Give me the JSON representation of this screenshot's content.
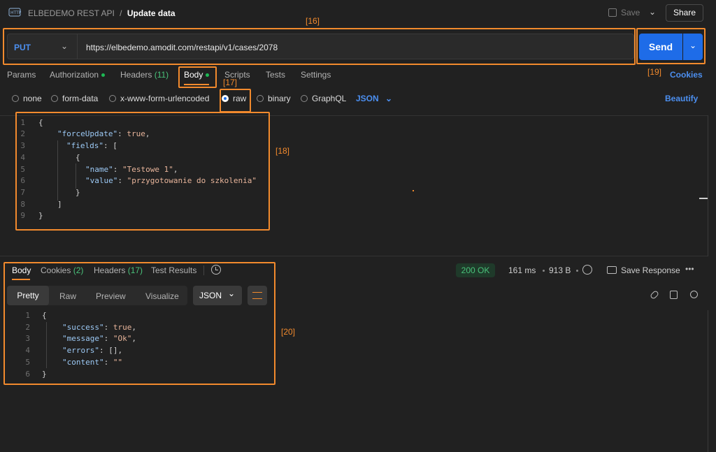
{
  "header": {
    "breadcrumb_collection": "ELBEDEMO REST API",
    "breadcrumb_sep": "/",
    "request_title": "Update data",
    "save_label": "Save",
    "share_label": "Share"
  },
  "request": {
    "method": "PUT",
    "url": "https://elbedemo.amodit.com/restapi/v1/cases/2078",
    "send_label": "Send",
    "cookies_label": "Cookies"
  },
  "request_tabs": {
    "params": "Params",
    "authorization": "Authorization",
    "headers": "Headers",
    "headers_count": "(11)",
    "body": "Body",
    "scripts": "Scripts",
    "tests": "Tests",
    "settings": "Settings"
  },
  "body_types": {
    "none": "none",
    "form_data": "form-data",
    "urlencoded": "x-www-form-urlencoded",
    "raw": "raw",
    "binary": "binary",
    "graphql": "GraphQL",
    "language": "JSON",
    "beautify": "Beautify"
  },
  "request_body": {
    "line_numbers": [
      "1",
      "2",
      "3",
      "4",
      "5",
      "6",
      "7",
      "8",
      "9"
    ],
    "l1": "{",
    "l2_key": "\"forceUpdate\"",
    "l2_rest": ": ",
    "l2_val": "true",
    "l2_end": ",",
    "l3_key": "\"fields\"",
    "l3_rest": ": [",
    "l4": "{",
    "l5_key": "\"name\"",
    "l5_rest": ": ",
    "l5_val": "\"Testowe 1\"",
    "l5_end": ",",
    "l6_key": "\"value\"",
    "l6_rest": ": ",
    "l6_val": "\"przygotowanie do szkolenia\"",
    "l7": "}",
    "l8": "]",
    "l9": "}"
  },
  "response_tabs": {
    "body": "Body",
    "cookies": "Cookies",
    "cookies_count": "(2)",
    "headers": "Headers",
    "headers_count": "(17)",
    "test_results": "Test Results"
  },
  "response_status": {
    "status": "200 OK",
    "time": "161 ms",
    "size": "913 B",
    "save_response": "Save Response"
  },
  "response_view": {
    "pretty": "Pretty",
    "raw": "Raw",
    "preview": "Preview",
    "visualize": "Visualize",
    "format": "JSON"
  },
  "response_body": {
    "line_numbers": [
      "1",
      "2",
      "3",
      "4",
      "5",
      "6"
    ],
    "l1": "{",
    "l2_key": "\"success\"",
    "l2_rest": ": ",
    "l2_val": "true",
    "l2_end": ",",
    "l3_key": "\"message\"",
    "l3_rest": ": ",
    "l3_val": "\"Ok\"",
    "l3_end": ",",
    "l4_key": "\"errors\"",
    "l4_rest": ": [],",
    "l5_key": "\"content\"",
    "l5_rest": ": ",
    "l5_val": "\"\"",
    "l6": "}"
  },
  "annotations": {
    "a16": "[16]",
    "a17": "[17]",
    "a18": "[18]",
    "a19": "[19]",
    "a20": "[20]"
  },
  "colors": {
    "accent_orange": "#f28a2d",
    "send_blue": "#1e6ce8",
    "status_green": "#49c27a"
  }
}
